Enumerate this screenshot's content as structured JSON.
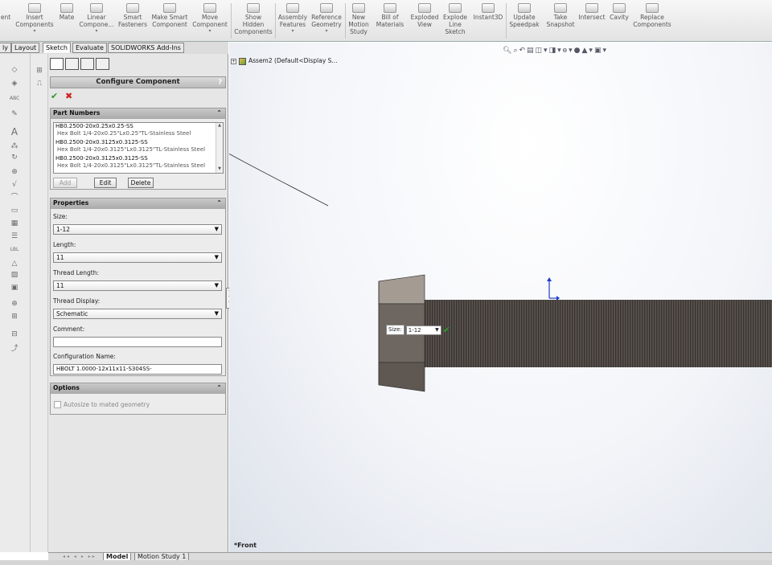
{
  "ribbon": {
    "buttons": [
      {
        "label": "ent",
        "x": 0,
        "icon": "component-icon"
      },
      {
        "label": "Insert\nComponents",
        "icon": "insert-components-icon",
        "dropdown": true
      },
      {
        "label": "Mate",
        "icon": "mate-icon"
      },
      {
        "label": "Linear\nCompone...",
        "icon": "linear-pattern-icon",
        "dropdown": true
      },
      {
        "label": "Smart\nFasteners",
        "icon": "smart-fasteners-icon"
      },
      {
        "label": "Make Smart\nComponent",
        "icon": "make-smart-component-icon"
      },
      {
        "label": "Move\nComponent",
        "icon": "move-component-icon",
        "dropdown": true
      },
      {
        "label": "Show\nHidden\nComponents",
        "icon": "show-hidden-icon"
      },
      {
        "label": "Assembly\nFeatures",
        "icon": "assembly-features-icon",
        "dropdown": true
      },
      {
        "label": "Reference\nGeometry",
        "icon": "reference-geometry-icon",
        "dropdown": true
      },
      {
        "label": "New\nMotion\nStudy",
        "icon": "new-motion-study-icon"
      },
      {
        "label": "Bill of\nMaterials",
        "icon": "bill-of-materials-icon"
      },
      {
        "label": "Exploded\nView",
        "icon": "exploded-view-icon"
      },
      {
        "label": "Explode\nLine\nSketch",
        "icon": "explode-line-sketch-icon"
      },
      {
        "label": "Instant3D",
        "icon": "instant3d-icon"
      },
      {
        "label": "Update\nSpeedpak",
        "icon": "update-speedpak-icon"
      },
      {
        "label": "Take\nSnapshot",
        "icon": "take-snapshot-icon"
      },
      {
        "label": "Intersect",
        "icon": "intersect-icon"
      },
      {
        "label": "Cavity",
        "icon": "cavity-icon"
      },
      {
        "label": "Replace\nComponents",
        "icon": "replace-components-icon"
      }
    ]
  },
  "tabs": [
    "ly",
    "Layout",
    "Sketch",
    "Evaluate",
    "SOLIDWORKS Add-Ins"
  ],
  "pm": {
    "title": "Configure Component",
    "help": "?",
    "ok": "✔",
    "cancel": "✖",
    "part_numbers": {
      "header": "Part Numbers",
      "items": [
        {
          "pn": "HB0.2500-20x0.25x0.25-SS",
          "desc": "Hex Bolt 1/4-20x0.25\"Lx0.25\"TL-Stainless Steel"
        },
        {
          "pn": "HB0.2500-20x0.3125x0.3125-SS",
          "desc": "Hex Bolt 1/4-20x0.3125\"Lx0.3125\"TL-Stainless Steel"
        },
        {
          "pn": "HB0.2500-20x0.3125x0.3125-SS",
          "desc": "Hex Bolt 1/4-20x0.3125\"Lx0.3125\"TL-Stainless Steel"
        }
      ],
      "add": "Add",
      "edit": "Edit",
      "delete": "Delete"
    },
    "properties": {
      "header": "Properties",
      "size_label": "Size:",
      "size_value": "1-12",
      "length_label": "Length:",
      "length_value": "11",
      "thread_length_label": "Thread Length:",
      "thread_length_value": "11",
      "thread_display_label": "Thread Display:",
      "thread_display_value": "Schematic",
      "comment_label": "Comment:",
      "comment_value": "",
      "config_name_label": "Configuration Name:",
      "config_name_value": "HBOLT 1.0000-12x11x11-S304SS-"
    },
    "options": {
      "header": "Options",
      "autosize_label": "Autosize to mated geometry",
      "autosize_checked": false
    }
  },
  "graphics": {
    "tree_item": "Assem2  (Default<Display S...",
    "view_name": "*Front",
    "size_popup_label": "Size:",
    "size_popup_value": "1-12"
  },
  "bottom_tabs": [
    "Model",
    "Motion Study 1"
  ],
  "colors": {
    "bolt_dark": "#5a5450",
    "bolt_mid": "#7a726c",
    "bolt_light": "#a49b93",
    "ok_green": "#2a9a2a",
    "cancel_red": "#cc2020"
  }
}
